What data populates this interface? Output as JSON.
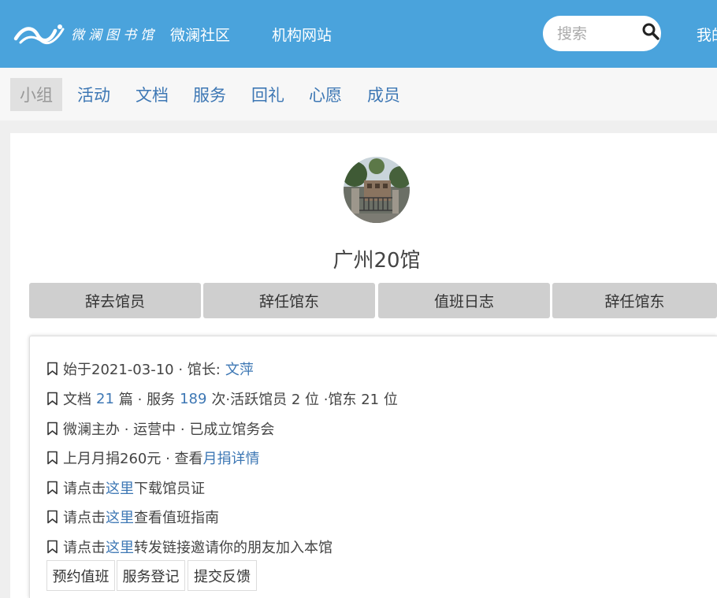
{
  "header": {
    "logo_text": "微澜图书馆",
    "nav_community": "微澜社区",
    "nav_site": "机构网站",
    "search_placeholder": "搜索",
    "right_link": "我的"
  },
  "subnav": {
    "items": [
      {
        "label": "小组",
        "active": true
      },
      {
        "label": "活动"
      },
      {
        "label": "文档"
      },
      {
        "label": "服务"
      },
      {
        "label": "回礼"
      },
      {
        "label": "心愿"
      },
      {
        "label": "成员"
      }
    ]
  },
  "group": {
    "name": "广州20馆",
    "actions": [
      "辞去馆员",
      "辞任馆东",
      "值班日志",
      "辞任馆东"
    ]
  },
  "info": {
    "started_prefix": "始于2021-03-10 · 馆长:",
    "curator": "文萍",
    "docs_prefix": "文档",
    "docs_count": "21",
    "docs_mid": "篇 · 服务",
    "service_count": "189",
    "docs_suffix": "次·活跃馆员 2 位 ·馆东 21 位",
    "status": "微澜主办 · 运营中  · 已成立馆务会",
    "donation_prefix": "上月月捐260元 · 查看",
    "donation_link": "月捐详情",
    "click_prefix": "请点击",
    "here": "这里",
    "download_suffix": "下载馆员证",
    "guide_suffix": "查看值班指南",
    "invite_suffix": "转发链接邀请你的朋友加入本馆"
  },
  "buttons": {
    "book_shift": "预约值班",
    "service_register": "服务登记",
    "feedback": "提交反馈"
  },
  "colors": {
    "header_bg": "#4aa3dc",
    "link": "#3d77b4",
    "action_bg": "#cfcfcf"
  }
}
